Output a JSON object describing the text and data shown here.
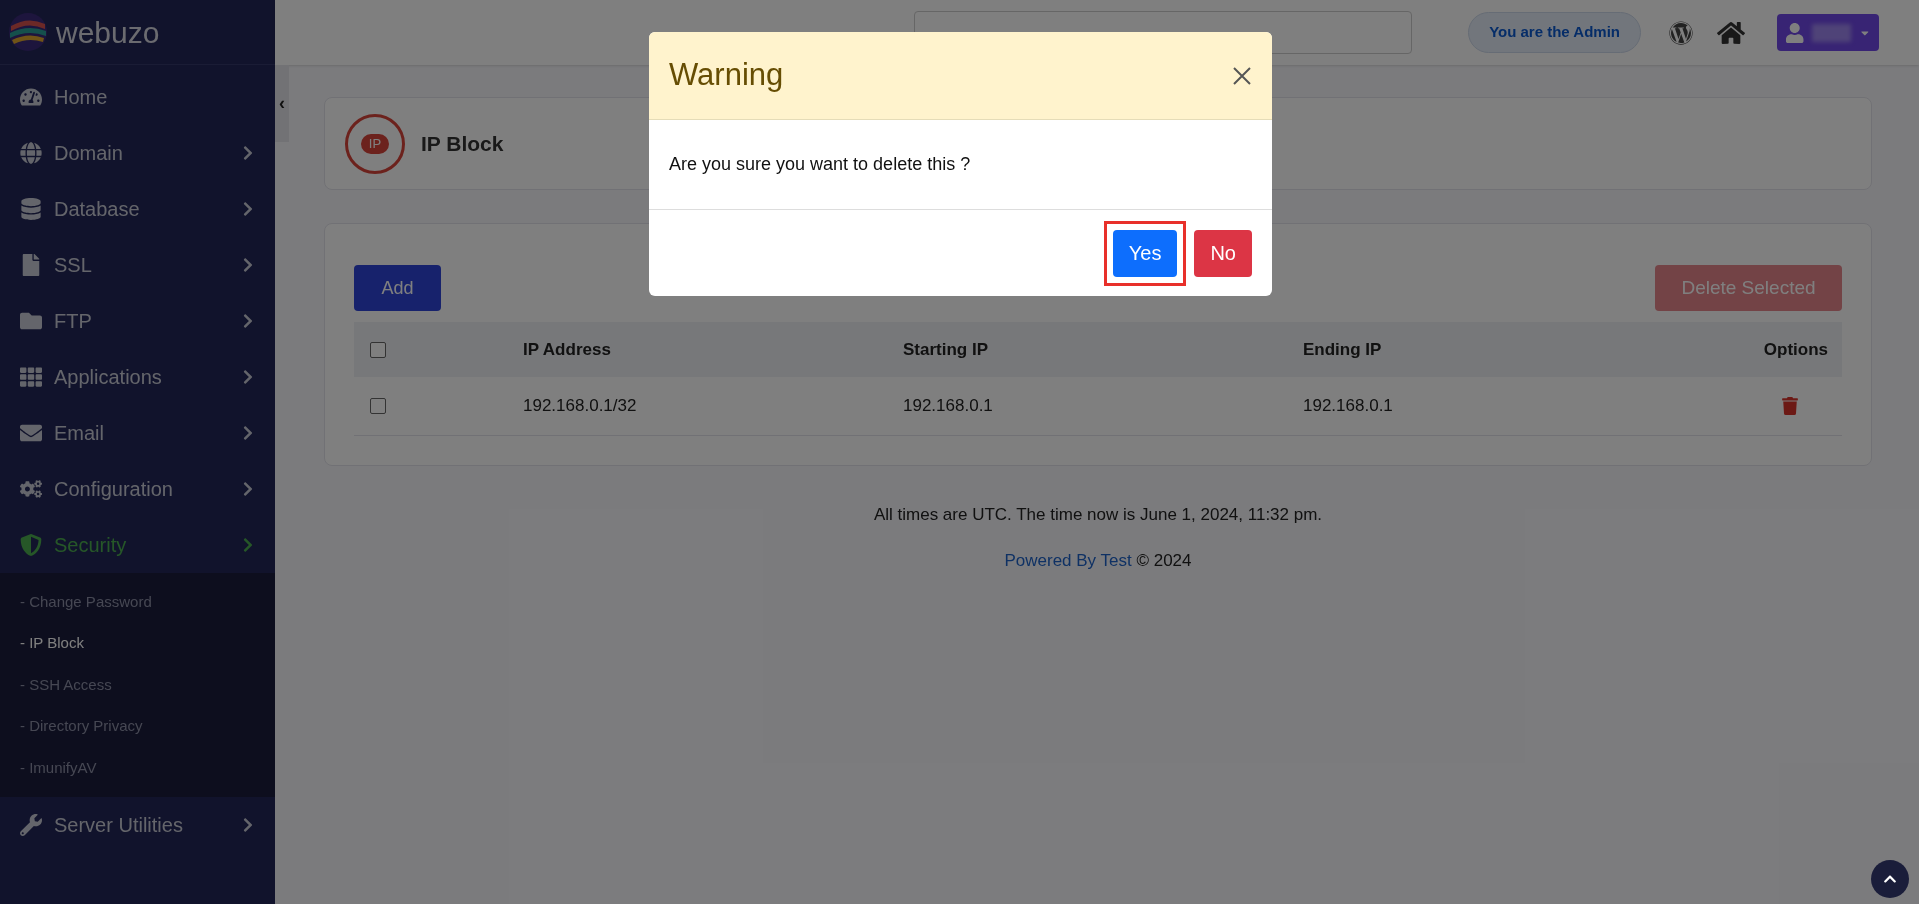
{
  "brand": "webuzo",
  "sidebar": {
    "items": [
      {
        "label": "Home",
        "has_arrow": false,
        "selected": false
      },
      {
        "label": "Domain",
        "has_arrow": true,
        "selected": false
      },
      {
        "label": "Database",
        "has_arrow": true,
        "selected": false
      },
      {
        "label": "SSL",
        "has_arrow": true,
        "selected": false
      },
      {
        "label": "FTP",
        "has_arrow": true,
        "selected": false
      },
      {
        "label": "Applications",
        "has_arrow": true,
        "selected": false
      },
      {
        "label": "Email",
        "has_arrow": true,
        "selected": false
      },
      {
        "label": "Configuration",
        "has_arrow": true,
        "selected": false
      },
      {
        "label": "Security",
        "has_arrow": true,
        "selected": true,
        "children": [
          {
            "label": "- Change Password",
            "selected": false
          },
          {
            "label": "- IP Block",
            "selected": true
          },
          {
            "label": "- SSH Access",
            "selected": false
          },
          {
            "label": "- Directory Privacy",
            "selected": false
          },
          {
            "label": "- ImunifyAV",
            "selected": false
          }
        ]
      },
      {
        "label": "Server Utilities",
        "has_arrow": true,
        "selected": false
      }
    ]
  },
  "collapse_toggle": "‹",
  "topbar": {
    "role_badge": "You are the Admin"
  },
  "page": {
    "icon_label": "IP",
    "title": "IP Block"
  },
  "actions": {
    "add": "Add",
    "delete_selected": "Delete Selected"
  },
  "table": {
    "select_all_checked": false,
    "columns": [
      "IP Address",
      "Starting IP",
      "Ending IP",
      "Options"
    ],
    "rows": [
      {
        "checked": false,
        "cells": [
          "192.168.0.1/32",
          "192.168.0.1",
          "192.168.0.1"
        ]
      }
    ]
  },
  "footer": {
    "time_note": "All times are UTC. The time now is June 1, 2024, 11:32 pm.",
    "powered_link": "Powered By Test",
    "copyright": "© 2024"
  },
  "modal": {
    "title": "Warning",
    "message": "Are you sure you want to delete this ?",
    "buttons": [
      {
        "label": "Yes",
        "kind": "confirm",
        "highlighted": true
      },
      {
        "label": "No",
        "kind": "cancel",
        "highlighted": false
      }
    ]
  }
}
